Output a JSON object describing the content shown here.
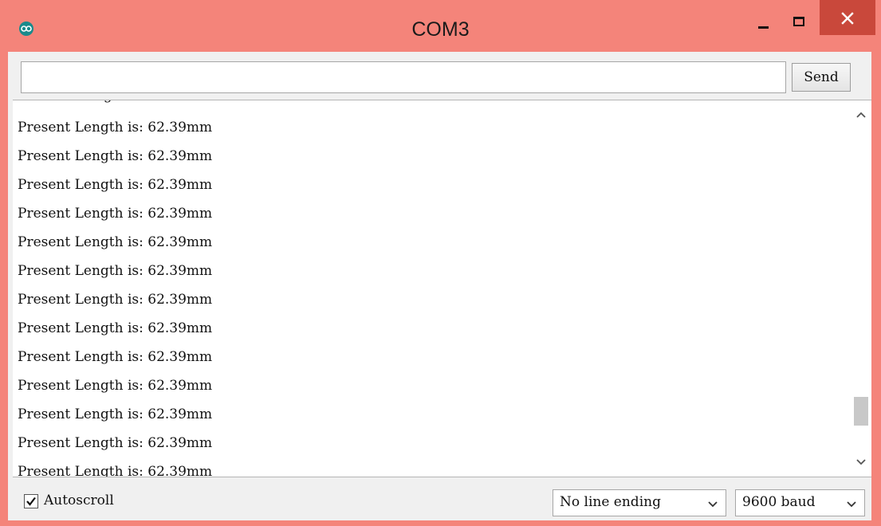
{
  "window": {
    "title": "COM3",
    "icons": {
      "app": "arduino-logo-icon",
      "minimize": "minimize-icon",
      "maximize": "maximize-icon",
      "close": "close-icon"
    },
    "colors": {
      "titlebar": "#f4847a",
      "close_button": "#c9483b",
      "app_icon": "#1a8a8c"
    }
  },
  "toolbar": {
    "input_value": "",
    "send_label": "Send"
  },
  "output": {
    "lines": [
      "Present Length is: 62.39mm",
      "Present Length is: 62.39mm",
      "Present Length is: 62.39mm",
      "Present Length is: 62.39mm",
      "Present Length is: 62.39mm",
      "Present Length is: 62.39mm",
      "Present Length is: 62.39mm",
      "Present Length is: 62.39mm",
      "Present Length is: 62.39mm",
      "Present Length is: 62.39mm",
      "Present Length is: 62.39mm",
      "Present Length is: 62.39mm",
      "Present Length is: 62.39mm"
    ],
    "scrollbar": {
      "up_icon": "chevron-up-icon",
      "down_icon": "chevron-down-icon"
    }
  },
  "footer": {
    "autoscroll_label": "Autoscroll",
    "autoscroll_checked": true,
    "line_ending": "No line ending",
    "baud_rate": "9600 baud"
  }
}
